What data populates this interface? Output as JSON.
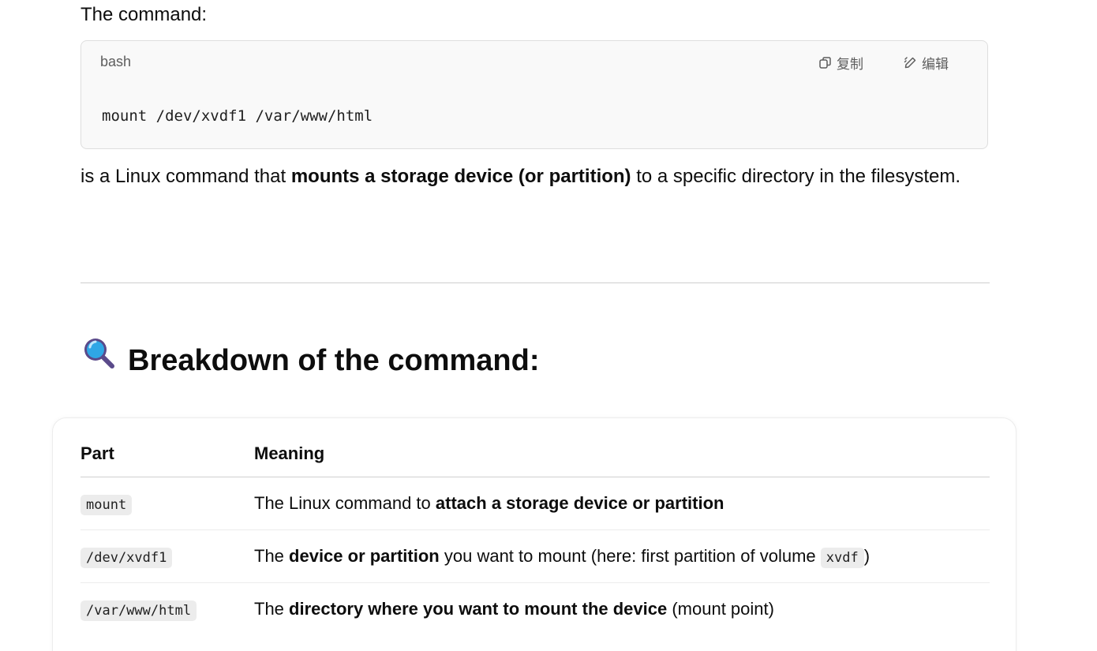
{
  "intro_text": "The command:",
  "code_block": {
    "language": "bash",
    "copy_label": "复制",
    "edit_label": "编辑",
    "code": "mount /dev/xvdf1 /var/www/html"
  },
  "description": {
    "prefix": "is a Linux command that ",
    "bold": "mounts a storage device (or partition)",
    "suffix": " to a specific directory in the filesystem."
  },
  "section": {
    "emoji": "🔍",
    "title": "Breakdown of the command:"
  },
  "table": {
    "headers": [
      "Part",
      "Meaning"
    ],
    "rows": [
      {
        "part": "mount",
        "m_prefix": "The Linux command to ",
        "m_bold": "attach a storage device or partition",
        "m_suffix": "",
        "m_code": "",
        "m_after": ""
      },
      {
        "part": "/dev/xvdf1",
        "m_prefix": "The ",
        "m_bold": "device or partition",
        "m_suffix": " you want to mount (here: first partition of volume ",
        "m_code": "xvdf",
        "m_after": ")"
      },
      {
        "part": "/var/www/html",
        "m_prefix": "The ",
        "m_bold": "directory where you want to mount the device",
        "m_suffix": " (mount point)",
        "m_code": "",
        "m_after": ""
      }
    ]
  },
  "icons": {
    "copy": "copy-icon",
    "edit": "edit-icon",
    "section": "magnifying-glass-icon"
  },
  "colors": {
    "code_bg": "#f9f9f9",
    "inline_code_bg": "#ececec",
    "text": "#0d0d0d",
    "muted": "#5d5d5d"
  }
}
